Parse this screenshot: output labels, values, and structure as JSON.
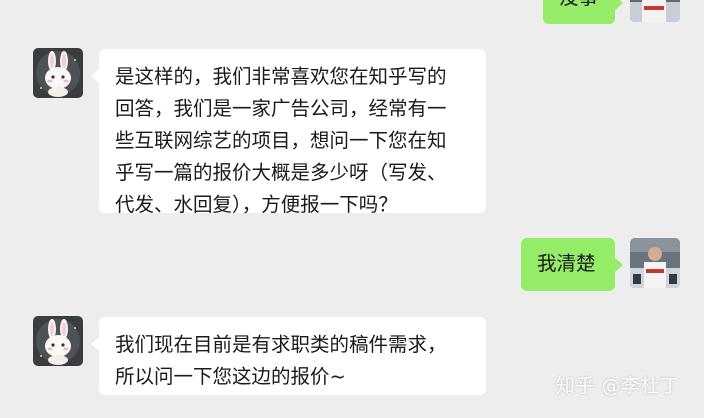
{
  "messages": [
    {
      "sender": "self",
      "text": "没事"
    },
    {
      "sender": "other",
      "lines": [
        "是这样的，我们非常喜欢您在知乎写的",
        "回答，我们是一家广告公司，经常有一",
        "些互联网综艺的项目，想问一下您在知",
        "乎写一篇的报价大概是多少呀（写发、",
        "代发、水回复），方便报一下吗？"
      ]
    },
    {
      "sender": "self",
      "text": "我清楚"
    },
    {
      "sender": "other",
      "lines": [
        "我们现在目前是有求职类的稿件需求，",
        "所以问一下您这边的报价~"
      ]
    }
  ],
  "watermark": "知乎 @李杜丁",
  "colors": {
    "background": "#ededed",
    "bubble_self": "#95ec69",
    "bubble_other": "#ffffff"
  },
  "avatars": {
    "other": "bunny-avatar-icon",
    "self": "person-photo-avatar-icon"
  }
}
